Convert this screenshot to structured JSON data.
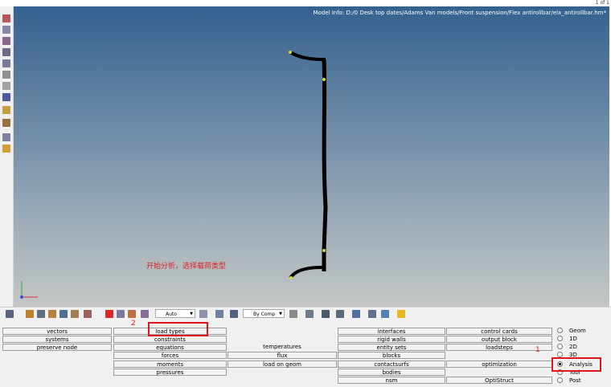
{
  "window": {
    "page_count": "1 of 1"
  },
  "viewport": {
    "model_info": "Model Info: D:/0 Desk top dates/Adams Van models/Front suspension/Flex antirollbar/elx_antirollbar.hm*",
    "annotation": "开始分析，选择载荷类型"
  },
  "toolbar": {
    "auto_select": "Auto",
    "comp_select": "By Comp"
  },
  "panel": {
    "col1": [
      "vectors",
      "systems",
      "preserve node"
    ],
    "col2": [
      "load types",
      "constraints",
      "equations",
      "forces",
      "moments",
      "pressures"
    ],
    "col3": [
      "temperatures",
      "flux",
      "load on geom"
    ],
    "col4": [
      "interfaces",
      "rigid walls",
      "entity sets",
      "blocks",
      "contactsurfs",
      "bodies",
      "nsm"
    ],
    "col5": [
      "control cards",
      "output block",
      "loadsteps",
      "optimization",
      "OptiStruct"
    ]
  },
  "radio_modes": [
    {
      "label": "Geom",
      "selected": false
    },
    {
      "label": "1D",
      "selected": false
    },
    {
      "label": "2D",
      "selected": false
    },
    {
      "label": "3D",
      "selected": false
    },
    {
      "label": "Analysis",
      "selected": true
    },
    {
      "label": "Tool",
      "selected": false
    },
    {
      "label": "Post",
      "selected": false
    }
  ],
  "step_markers": {
    "step1": "1",
    "step2": "2"
  },
  "colors": {
    "highlight": "#e0161a",
    "viewport_top": "#35618f",
    "viewport_bottom": "#c3c6c4"
  }
}
